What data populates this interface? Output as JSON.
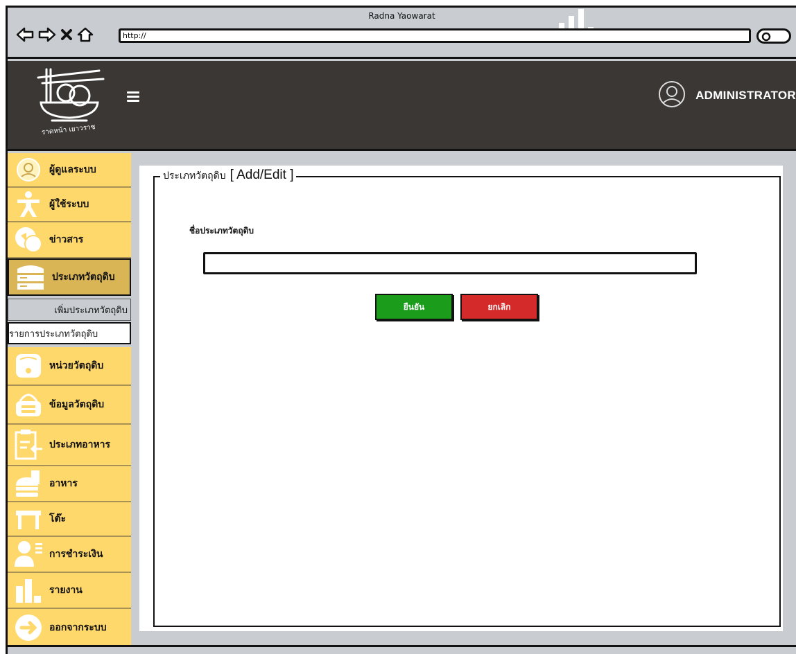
{
  "browser": {
    "title": "Radna Yaowarat",
    "url": "http://"
  },
  "header": {
    "logo_text": "ราดหน้า เยาวราช",
    "user_label": "ADMINISTRATOR"
  },
  "sidebar": {
    "items": [
      {
        "label": "ผู้ดูแลระบบ",
        "icon": "admin-icon"
      },
      {
        "label": "ผู้ใช้ระบบ",
        "icon": "user-icon"
      },
      {
        "label": "ข่าวสาร",
        "icon": "chat-icon"
      },
      {
        "label": "ประเภทวัตถุดิบ",
        "icon": "server-icon"
      },
      {
        "label": "หน่วยวัตถุดิบ",
        "icon": "scale-icon"
      },
      {
        "label": "ข้อมูลวัตถุดิบ",
        "icon": "basket-icon"
      },
      {
        "label": "ประเภทอาหาร",
        "icon": "clipboard-icon"
      },
      {
        "label": "อาหาร",
        "icon": "fastfood-icon"
      },
      {
        "label": "โต๊ะ",
        "icon": "table-icon"
      },
      {
        "label": "การชำระเงิน",
        "icon": "person-list-icon"
      },
      {
        "label": "รายงาน",
        "icon": "chart-icon"
      },
      {
        "label": "ออกจากระบบ",
        "icon": "logout-icon"
      }
    ],
    "sub_items": [
      {
        "label": "เพิ่มประเภทวัตถุดิบ"
      },
      {
        "label": "รายการประเภทวัตถุดิบ"
      }
    ]
  },
  "form": {
    "legend_thai": "ประเภทวัตถุดิบ",
    "legend_mode": "[ Add/Edit ]",
    "field_label": "ชื่อประเภทวัตถุดิบ",
    "field_value": "",
    "confirm_label": "ยืนยัน",
    "cancel_label": "ยกเลิก"
  },
  "colors": {
    "sidebar": "#ffd86b",
    "header": "#3a3735",
    "confirm": "#1b9c1b",
    "cancel": "#d42a2a"
  }
}
